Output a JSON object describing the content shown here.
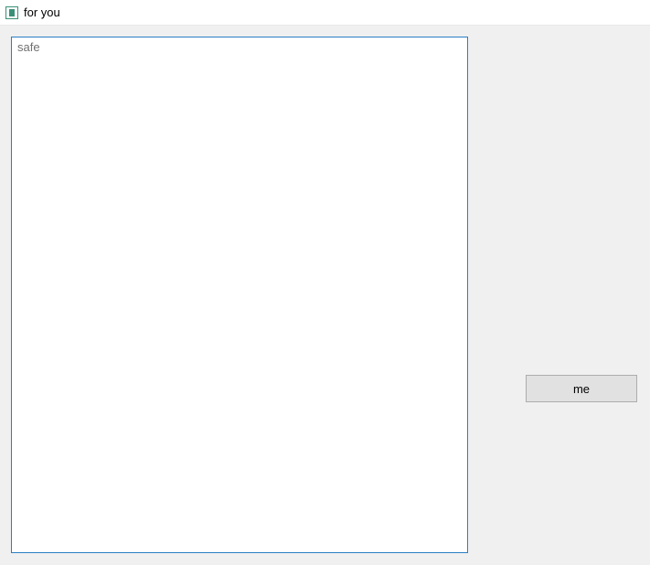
{
  "window": {
    "title": "for you"
  },
  "main": {
    "textarea": {
      "value": "",
      "placeholder": "safe"
    },
    "button": {
      "label": "me"
    }
  }
}
